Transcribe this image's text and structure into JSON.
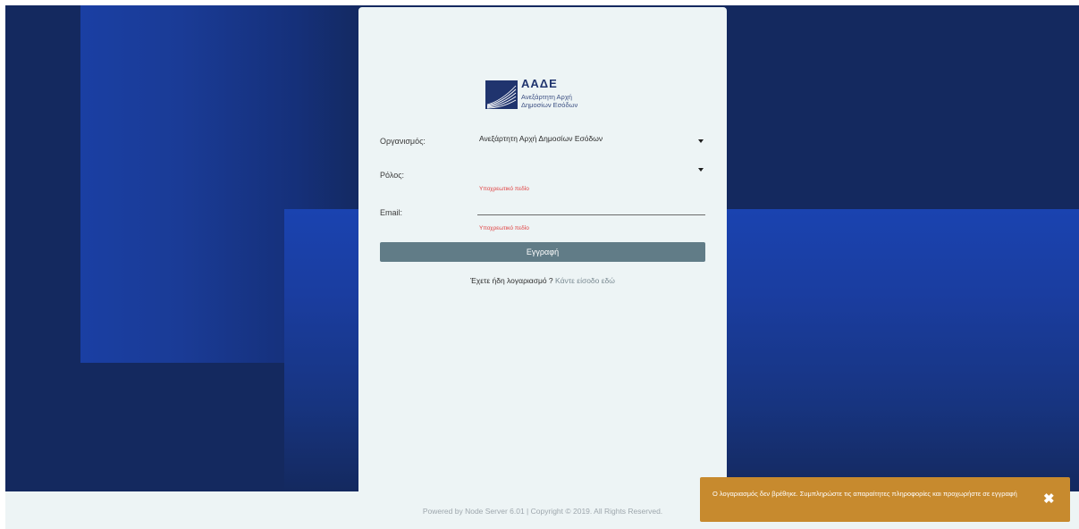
{
  "logo": {
    "title": "ΑΑΔΕ",
    "subtitle_line1": "Ανεξάρτητη Αρχή",
    "subtitle_line2": "Δημοσίων Εσόδων"
  },
  "form": {
    "organization": {
      "label": "Οργανισμός:",
      "value": "Ανεξάρτητη Αρχή Δημοσίων Εσόδων"
    },
    "role": {
      "label": "Ρόλος:",
      "value": "",
      "error": "Υποχρεωτικό πεδίο"
    },
    "email": {
      "label": "Email:",
      "value": "",
      "error": "Υποχρεωτικό πεδίο"
    },
    "submit_label": "Εγγραφή",
    "login_prompt": "Έχετε ήδη λογαριασμό ?",
    "login_link": "Κάντε είσοδο εδώ"
  },
  "footer": {
    "text": "Powered by Node Server 6.01 | Copyright © 2019. All Rights Reserved."
  },
  "toast": {
    "message": "Ο λογαριασμός δεν βρέθηκε. Συμπληρώστε τις απαραίτητες πληροφορίες και προχωρήστε σε εγγραφή",
    "close_glyph": "✖"
  },
  "colors": {
    "background": "#14295f",
    "card": "#edf4f5",
    "button": "#617c87",
    "error": "#e04040",
    "toast": "#c78a2e"
  }
}
